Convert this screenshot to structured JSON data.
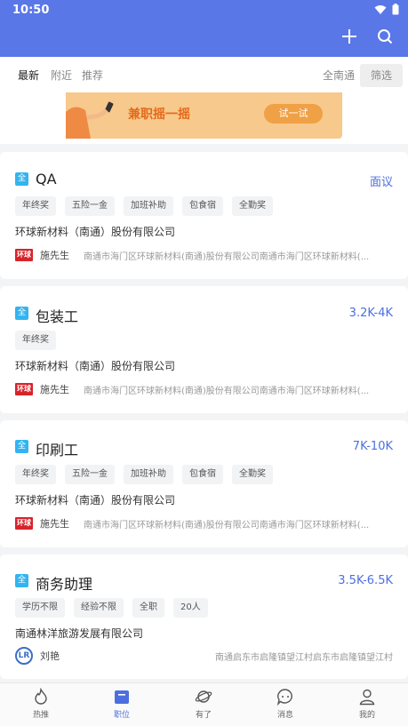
{
  "status": {
    "time": "10:50",
    "icons": [
      "wifi-icon",
      "battery-icon"
    ]
  },
  "appbar": {
    "actions": [
      "add-icon",
      "search-icon"
    ]
  },
  "filters": {
    "tabs": [
      "最新",
      "附近",
      "推荐"
    ],
    "city": "全南通",
    "filter_button": "筛选"
  },
  "banner": {
    "text": "兼职摇一摇",
    "button": "试一试"
  },
  "jobs": [
    {
      "badge": "全",
      "title": "QA",
      "salary": "面议",
      "tags": [
        "年终奖",
        "五险一金",
        "加班补助",
        "包食宿",
        "全勤奖"
      ],
      "company": "环球新材料（南通）股份有限公司",
      "contact": "施先生",
      "logo": "环球",
      "address": "南通市海门区环球新材料(南通)股份有限公司南通市海门区环球新材料(..."
    },
    {
      "badge": "全",
      "title": "包装工",
      "salary": "3.2K-4K",
      "tags": [
        "年终奖"
      ],
      "company": "环球新材料（南通）股份有限公司",
      "contact": "施先生",
      "logo": "环球",
      "address": "南通市海门区环球新材料(南通)股份有限公司南通市海门区环球新材料(..."
    },
    {
      "badge": "全",
      "title": "印刷工",
      "salary": "7K-10K",
      "tags": [
        "年终奖",
        "五险一金",
        "加班补助",
        "包食宿",
        "全勤奖"
      ],
      "company": "环球新材料（南通）股份有限公司",
      "contact": "施先生",
      "logo": "环球",
      "address": "南通市海门区环球新材料(南通)股份有限公司南通市海门区环球新材料(..."
    },
    {
      "badge": "全",
      "title": "商务助理",
      "salary": "3.5K-6.5K",
      "tags": [
        "学历不限",
        "经验不限",
        "全职",
        "20人"
      ],
      "company": "南通林洋旅游发展有限公司",
      "contact": "刘艳",
      "logo": "LR",
      "address": "南通启东市启隆镇望江村启东市启隆镇望江村"
    }
  ],
  "nav": [
    {
      "label": "热推",
      "icon": "fire-icon"
    },
    {
      "label": "职位",
      "icon": "briefcase-icon"
    },
    {
      "label": "有了",
      "icon": "planet-icon"
    },
    {
      "label": "消息",
      "icon": "chat-icon"
    },
    {
      "label": "我的",
      "icon": "user-icon"
    }
  ],
  "colors": {
    "primary": "#5a77e8",
    "salary": "#4c6fe0",
    "badge": "#33b4f0"
  }
}
